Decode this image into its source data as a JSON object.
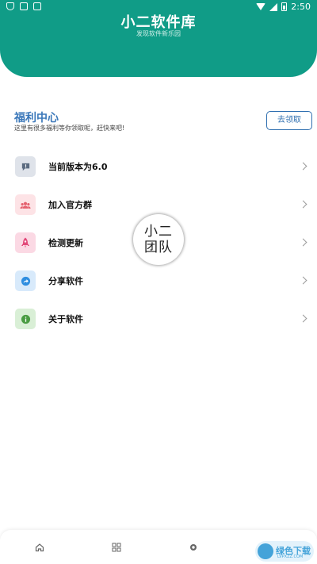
{
  "status_bar": {
    "time": "2:50"
  },
  "header": {
    "title": "小二软件库",
    "subtitle": "发现软件新乐园"
  },
  "welfare": {
    "title": "福利中心",
    "description": "这里有很多福利等你领取呢，赶快来吧!",
    "claim_button": "去领取"
  },
  "menu": {
    "items": [
      {
        "label": "当前版本为6.0",
        "icon": "message-icon",
        "icon_bg": "#dfe3ea",
        "icon_color": "#5b6b80"
      },
      {
        "label": "加入官方群",
        "icon": "group-icon",
        "icon_bg": "#fde3e6",
        "icon_color": "#e4606e"
      },
      {
        "label": "检测更新",
        "icon": "rocket-icon",
        "icon_bg": "#fbd9e4",
        "icon_color": "#e24a7a"
      },
      {
        "label": "分享软件",
        "icon": "share-icon",
        "icon_bg": "#d8eafb",
        "icon_color": "#2f8ee0"
      },
      {
        "label": "关于软件",
        "icon": "info-icon",
        "icon_bg": "#d9efd6",
        "icon_color": "#4a9c43"
      }
    ]
  },
  "badge": {
    "line1": "小二",
    "line2": "团队"
  },
  "bottom_nav": {
    "items": [
      {
        "icon": "home-icon"
      },
      {
        "icon": "apps-grid-icon"
      },
      {
        "icon": "discover-icon"
      }
    ]
  },
  "watermark": {
    "text": "绿色下载",
    "sub": "LVPXZZ.COM"
  },
  "colors": {
    "primary": "#109c87",
    "accent": "#3b78ba"
  }
}
